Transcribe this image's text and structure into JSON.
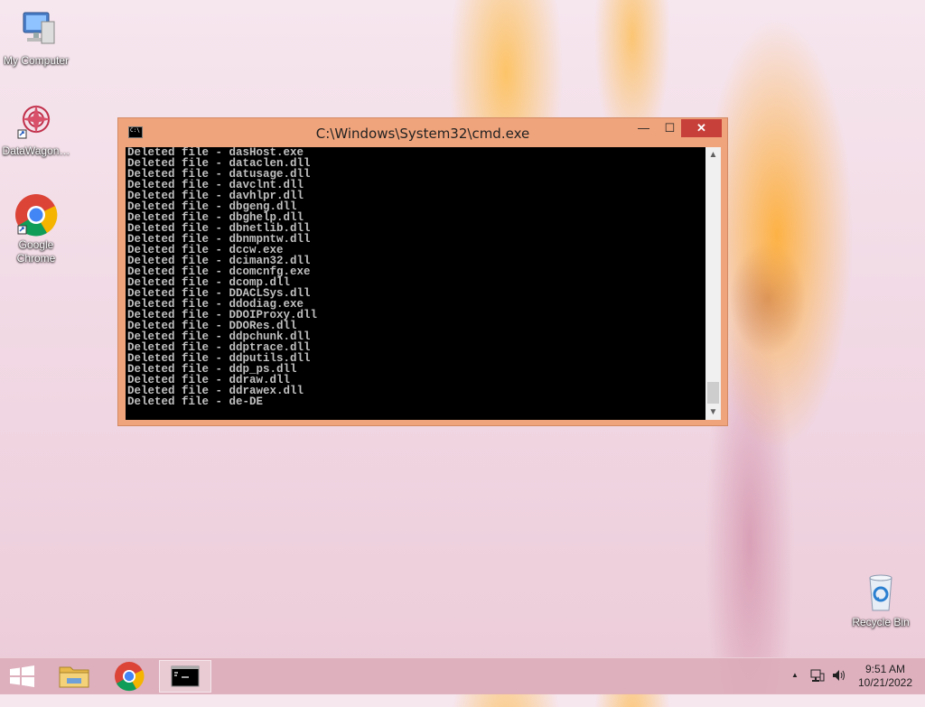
{
  "desktop": {
    "icons": [
      {
        "label": "My Computer"
      },
      {
        "label": "DataWagon…"
      },
      {
        "label": "Google Chrome"
      },
      {
        "label": "Recycle Bin"
      }
    ]
  },
  "window": {
    "title": "C:\\Windows\\System32\\cmd.exe",
    "minimize": "—",
    "maximize": "☐",
    "close": "✕",
    "lines": [
      "Deleted file - dasHost.exe",
      "Deleted file - dataclen.dll",
      "Deleted file - datusage.dll",
      "Deleted file - davclnt.dll",
      "Deleted file - davhlpr.dll",
      "Deleted file - dbgeng.dll",
      "Deleted file - dbghelp.dll",
      "Deleted file - dbnetlib.dll",
      "Deleted file - dbnmpntw.dll",
      "Deleted file - dccw.exe",
      "Deleted file - dciman32.dll",
      "Deleted file - dcomcnfg.exe",
      "Deleted file - dcomp.dll",
      "Deleted file - DDACLSys.dll",
      "Deleted file - ddodiag.exe",
      "Deleted file - DDOIProxy.dll",
      "Deleted file - DDORes.dll",
      "Deleted file - ddpchunk.dll",
      "Deleted file - ddptrace.dll",
      "Deleted file - ddputils.dll",
      "Deleted file - ddp_ps.dll",
      "Deleted file - ddraw.dll",
      "Deleted file - ddrawex.dll",
      "Deleted file - de-DE"
    ],
    "scroll_up": "▲",
    "scroll_down": "▼"
  },
  "taskbar": {
    "time": "9:51 AM",
    "date": "10/21/2022",
    "tray_chevron": "▲"
  },
  "colors": {
    "window_frame": "#f0a47c",
    "close_button": "#c7403a",
    "console_bg": "#000000",
    "console_text": "#c0c0c0"
  }
}
